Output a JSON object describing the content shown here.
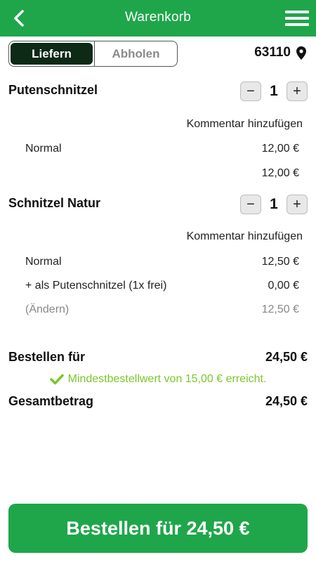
{
  "header": {
    "title": "Warenkorb",
    "back_icon": "chevron-left-icon",
    "menu_icon": "hamburger-menu-icon"
  },
  "delivery_toggle": {
    "deliver_label": "Liefern",
    "pickup_label": "Abholen",
    "selected": "Liefern"
  },
  "location": {
    "zip": "63110",
    "icon": "map-pin-icon"
  },
  "items": [
    {
      "name": "Putenschnitzel",
      "quantity": "1",
      "comment_label": "Kommentar hinzufügen",
      "lines": [
        {
          "label": "Normal",
          "price": "12,00 €"
        },
        {
          "label": "",
          "price": "12,00 €"
        }
      ]
    },
    {
      "name": "Schnitzel Natur",
      "quantity": "1",
      "comment_label": "Kommentar hinzufügen",
      "lines": [
        {
          "label": "Normal",
          "price": "12,50 €"
        },
        {
          "label": "+ als Putenschnitzel (1x frei)",
          "price": "0,00 €"
        },
        {
          "label": "(Ändern)",
          "price": "12,50 €"
        }
      ]
    }
  ],
  "stepper": {
    "minus": "−",
    "plus": "+"
  },
  "summary": {
    "order_for_label": "Bestellen für",
    "order_for_value": "24,50 €",
    "min_order_notice": "Mindestbestellwert von 15,00 € erreicht.",
    "total_label": "Gesamtbetrag",
    "total_value": "24,50 €"
  },
  "order_button": {
    "label": "Bestellen für 24,50 €"
  },
  "colors": {
    "primary": "#1fa64a",
    "toggle_active": "#0c2a16",
    "notice": "#7cc62a"
  }
}
